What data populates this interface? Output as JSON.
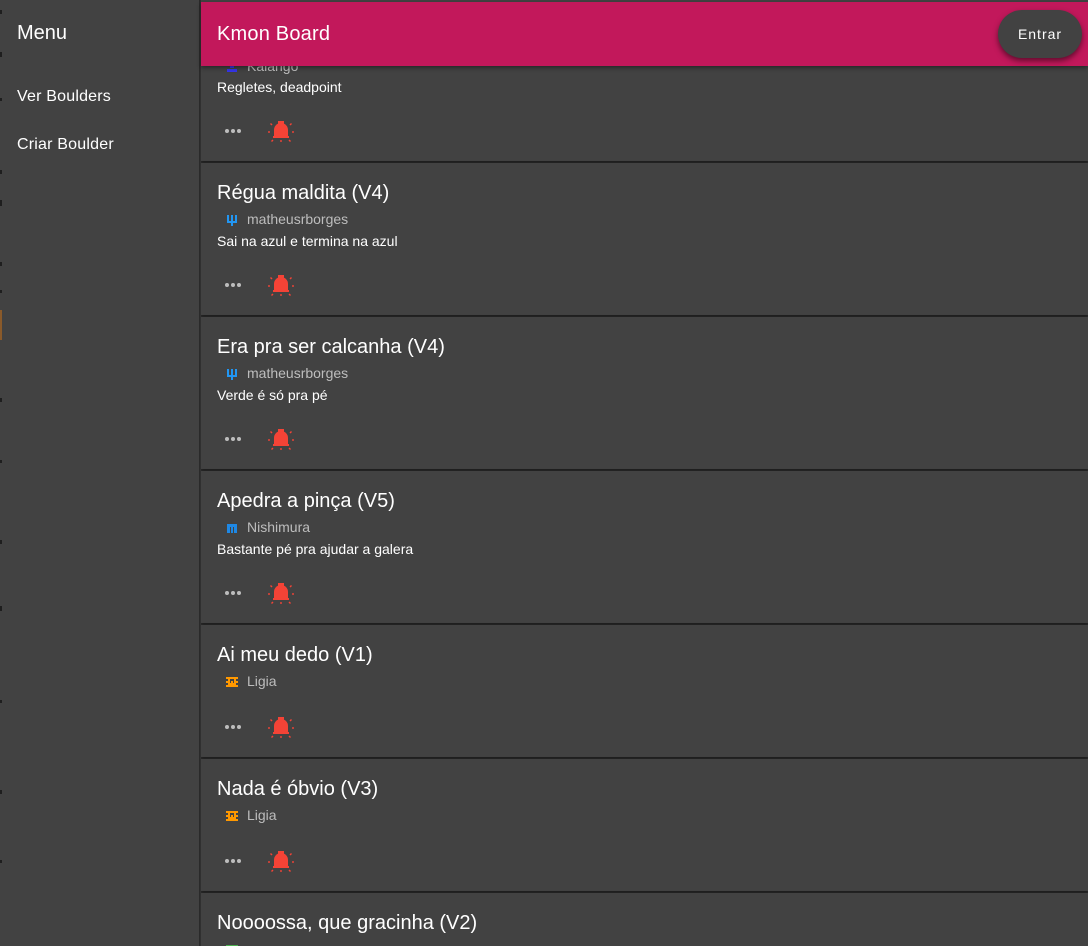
{
  "sidebar": {
    "title": "Menu",
    "items": [
      {
        "label": "Ver Boulders"
      },
      {
        "label": "Criar Boulder"
      }
    ]
  },
  "header": {
    "title": "Kmon Board",
    "login_label": "Entrar",
    "color": "#c2185b"
  },
  "colors": {
    "background": "#303030",
    "card": "#424242",
    "accent": "#c2185b",
    "light_icon": "#f44336"
  },
  "boulders": [
    {
      "title": "",
      "author": "Kalango",
      "author_icon": "identicon-blue",
      "author_color": "#3030e0",
      "description": "Regletes, deadpoint"
    },
    {
      "title": "Régua maldita (V4)",
      "author": "matheusrborges",
      "author_icon": "identicon-blue",
      "author_color": "#2196f3",
      "description": "Sai na azul e termina na azul"
    },
    {
      "title": "Era pra ser calcanha (V4)",
      "author": "matheusrborges",
      "author_icon": "identicon-blue",
      "author_color": "#2196f3",
      "description": "Verde é só pra pé"
    },
    {
      "title": "Apedra a pinça (V5)",
      "author": "Nishimura",
      "author_icon": "identicon-blue",
      "author_color": "#1e88e5",
      "description": "Bastante pé pra ajudar a galera"
    },
    {
      "title": "Ai meu dedo (V1)",
      "author": "Ligia",
      "author_icon": "identicon-orange",
      "author_color": "#ff9800",
      "description": ""
    },
    {
      "title": "Nada é óbvio (V3)",
      "author": "Ligia",
      "author_icon": "identicon-orange",
      "author_color": "#ff9800",
      "description": ""
    },
    {
      "title": "Noooossa, que gracinha (V2)",
      "author": "",
      "author_icon": "identicon-green",
      "author_color": "#4caf50",
      "description": ""
    }
  ],
  "icons": {
    "more": "more-horiz-icon",
    "light": "lightbulb-icon"
  }
}
